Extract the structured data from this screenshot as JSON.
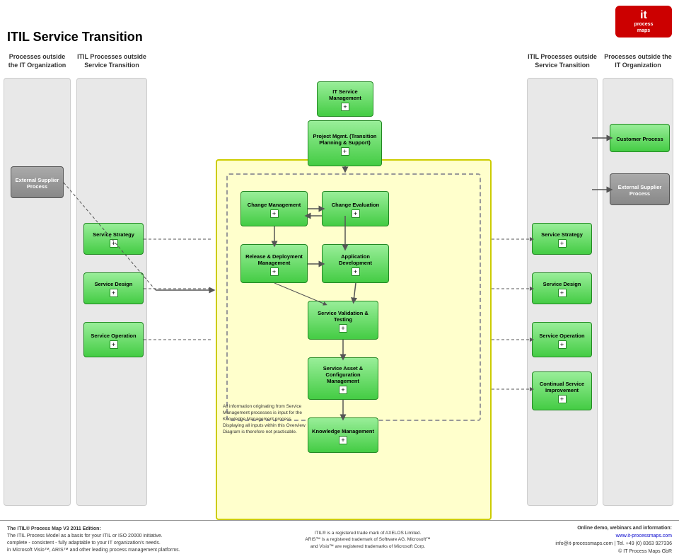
{
  "title": "ITIL Service Transition",
  "logo": {
    "it": "it",
    "process": "process",
    "maps": "maps"
  },
  "columns": {
    "left_outer": {
      "header": "Processes outside the IT Organization"
    },
    "left_inner": {
      "header": "ITIL Processes outside Service Transition"
    },
    "right_inner": {
      "header": "ITIL Processes outside Service Transition"
    },
    "right_outer": {
      "header": "Processes outside the IT Organization"
    }
  },
  "boxes": {
    "it_service_mgmt": {
      "label": "IT Service Management",
      "plus": "+"
    },
    "project_mgmt": {
      "label": "Project Mgmt. (Transition Planning & Support)",
      "plus": "+"
    },
    "change_mgmt": {
      "label": "Change Management",
      "plus": "+"
    },
    "change_eval": {
      "label": "Change Evaluation",
      "plus": "+"
    },
    "release_deploy": {
      "label": "Release & Deployment Management",
      "plus": "+"
    },
    "app_dev": {
      "label": "Application Development",
      "plus": "+"
    },
    "service_val": {
      "label": "Service Validation & Testing",
      "plus": "+"
    },
    "service_asset": {
      "label": "Service Asset & Configuration Management",
      "plus": "+"
    },
    "knowledge": {
      "label": "Knowledge Management",
      "plus": "+"
    },
    "ext_supplier": {
      "label": "External Supplier Process",
      "plus": null
    },
    "svc_strategy_left": {
      "label": "Service Strategy",
      "plus": "+"
    },
    "svc_design_left": {
      "label": "Service Design",
      "plus": "+"
    },
    "svc_operation_left": {
      "label": "Service Operation",
      "plus": "+"
    },
    "customer_right": {
      "label": "Customer Process",
      "plus": null
    },
    "ext_supplier_right": {
      "label": "External Supplier Process",
      "plus": null
    },
    "svc_strategy_right": {
      "label": "Service Strategy",
      "plus": "+"
    },
    "svc_design_right": {
      "label": "Service Design",
      "plus": "+"
    },
    "svc_operation_right": {
      "label": "Service Operation",
      "plus": "+"
    },
    "continual_right": {
      "label": "Continual Service Improvement",
      "plus": "+"
    }
  },
  "note": "All information originating from Service Management processes is input for the Knowledge Management process. Displaying all inputs within this Overview Diagram is therefore not practicable.",
  "footer": {
    "left_bold": "The ITIL® Process Map V3 2011 Edition:",
    "left_text": "The ITIL Process Model as a basis for your ITIL or ISO 20000 initiative.\ncomplete - consistent - fully adaptable to your IT organization's needs.\nin Microsoft Visio™, ARIS™ and other leading process management platforms.",
    "center_text": "ITIL® is a registered trade mark of AXELOS Limited.\nARIS™ is a registered trademark of Software AG. Microsoft™\nand Visio™ are registered trademarks of Microsoft Corp.",
    "right_bold": "Online demo, webinars and information:",
    "right_url": "www.it-processmaps.com",
    "right_tel": "Tel. +49 (0) 8363 927336",
    "right_email": "info@it-processmaps.com"
  }
}
